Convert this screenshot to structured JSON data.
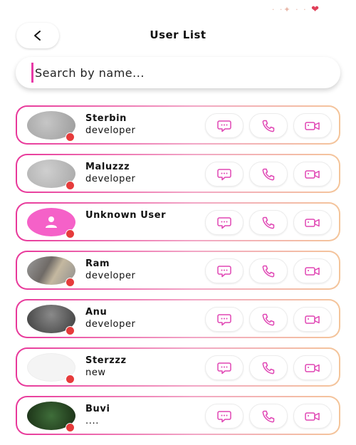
{
  "header": {
    "title": "User List",
    "back_icon": "chevron-left-icon"
  },
  "search": {
    "placeholder": "Search by name..."
  },
  "colors": {
    "accent": "#e8379a",
    "status_dot": "#e63b3b",
    "default_avatar": "#f561c8",
    "action_icon": "#e046b4"
  },
  "users": [
    {
      "name": "Sterbin",
      "role": "developer",
      "avatar": "gray"
    },
    {
      "name": "Maluzzz",
      "role": "developer",
      "avatar": "gray-light"
    },
    {
      "name": "Unknown User",
      "role": "",
      "avatar": "default"
    },
    {
      "name": "Ram",
      "role": "developer",
      "avatar": "photo-ram"
    },
    {
      "name": "Anu",
      "role": "developer",
      "avatar": "dark"
    },
    {
      "name": "Sterzzz",
      "role": "new",
      "avatar": "blank"
    },
    {
      "name": "Buvi",
      "role": "....",
      "avatar": "photo-buvi"
    }
  ],
  "action_icons": [
    "chat-icon",
    "phone-icon",
    "video-icon"
  ]
}
